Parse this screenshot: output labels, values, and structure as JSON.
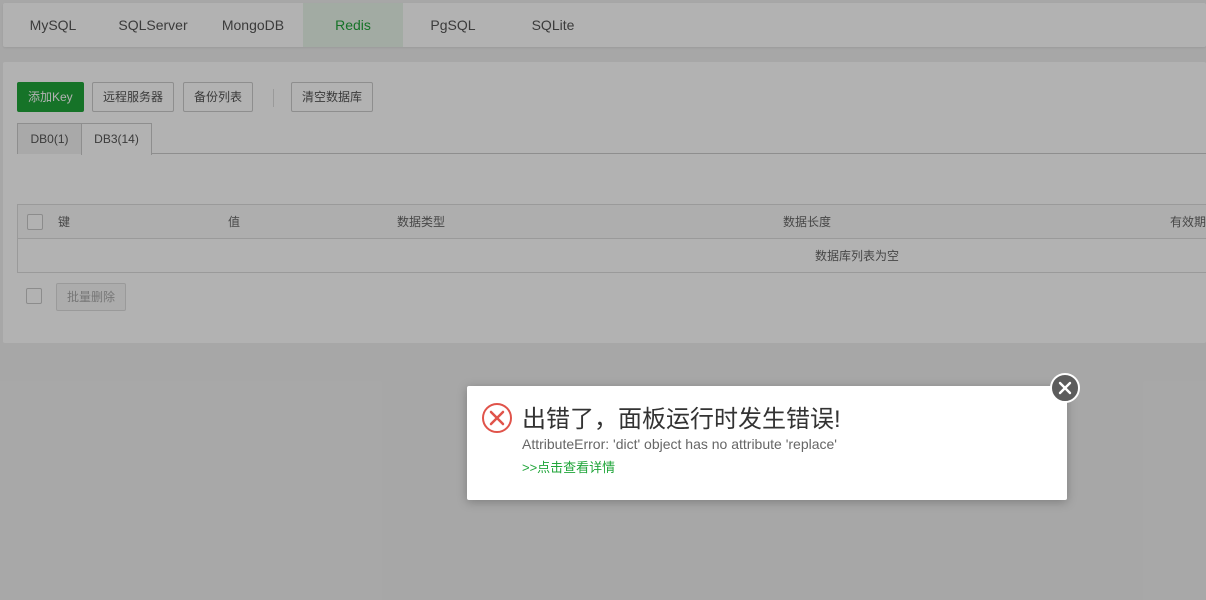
{
  "top_tabs": [
    {
      "label": "MySQL"
    },
    {
      "label": "SQLServer"
    },
    {
      "label": "MongoDB"
    },
    {
      "label": "Redis",
      "active": true
    },
    {
      "label": "PgSQL"
    },
    {
      "label": "SQLite"
    }
  ],
  "toolbar": {
    "add_key": "添加Key",
    "remote_server": "远程服务器",
    "backup_list": "备份列表",
    "clear_db": "清空数据库"
  },
  "db_tabs": [
    {
      "label": "DB0(1)"
    },
    {
      "label": "DB3(14)",
      "active": true
    }
  ],
  "table": {
    "headers": [
      "键",
      "值",
      "数据类型",
      "数据长度",
      "有效期"
    ],
    "empty_text": "数据库列表为空"
  },
  "batch_delete": "批量删除",
  "error_dialog": {
    "title": "出错了，面板运行时发生错误!",
    "message": "AttributeError: 'dict' object has no attribute 'replace'",
    "details_link": ">>点击查看详情"
  },
  "icons": {
    "error": "error-circle-icon",
    "close": "close-icon"
  },
  "colors": {
    "accent": "#20a53a",
    "error": "#e0534a"
  }
}
